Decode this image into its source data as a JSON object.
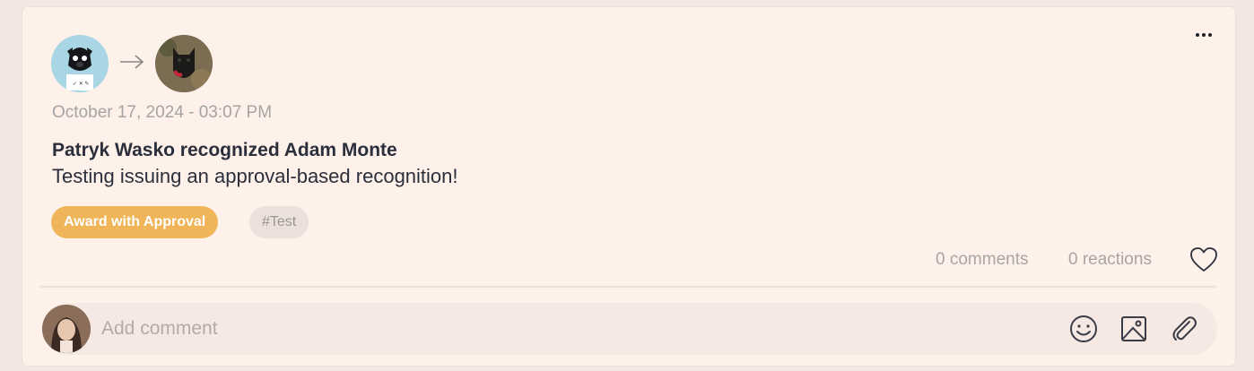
{
  "post": {
    "date": "October 17, 2024 - 03:07 PM",
    "headline": "Patryk Wasko recognized Adam Monte",
    "message": "Testing issuing an approval-based recognition!",
    "award_badge": "Award with Approval",
    "tag": "#Test",
    "comments_count": "0 comments",
    "reactions_count": "0 reactions"
  },
  "comment_box": {
    "placeholder": "Add comment"
  },
  "icons": [
    "more-icon",
    "arrow-right-icon",
    "heart-icon",
    "emoji-icon",
    "image-icon",
    "attachment-icon"
  ],
  "colors": {
    "award_badge": "#f0b558",
    "card_background": "#fdf1ea"
  }
}
